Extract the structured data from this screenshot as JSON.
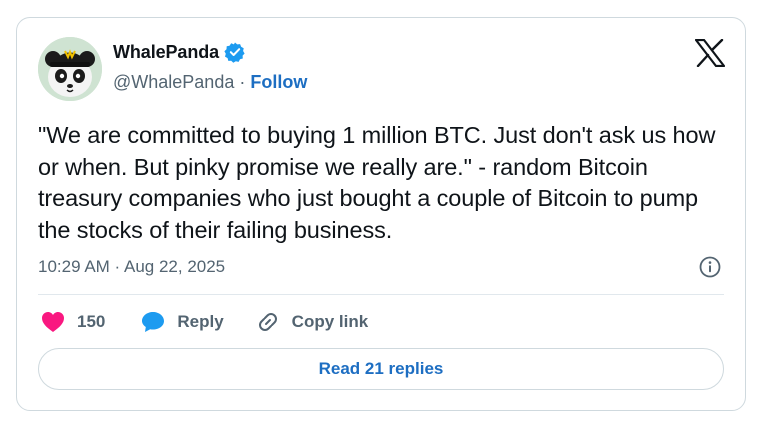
{
  "author": {
    "name": "WhalePanda",
    "handle": "@WhalePanda",
    "separator": "·",
    "follow_label": "Follow"
  },
  "tweet": {
    "text": "\"We are committed to buying 1 million BTC. Just don't ask us how or when. But pinky promise we really are.\" - random Bitcoin treasury companies who just bought a couple of Bitcoin to pump the stocks of their failing business.",
    "timestamp": "10:29 AM · Aug 22, 2025"
  },
  "actions": {
    "like_count": "150",
    "reply_label": "Reply",
    "copy_link_label": "Copy link"
  },
  "read_replies_label": "Read 21 replies",
  "icons": {
    "logo": "x-logo-icon",
    "verified": "verified-badge-icon",
    "info": "info-icon",
    "like": "heart-icon",
    "reply": "speech-bubble-icon",
    "copy_link": "link-icon"
  },
  "colors": {
    "accent": "#1d6ec2",
    "like": "#f91880",
    "verified": "#1d9bf0",
    "muted_text": "#536471",
    "border": "#cfd9de"
  }
}
